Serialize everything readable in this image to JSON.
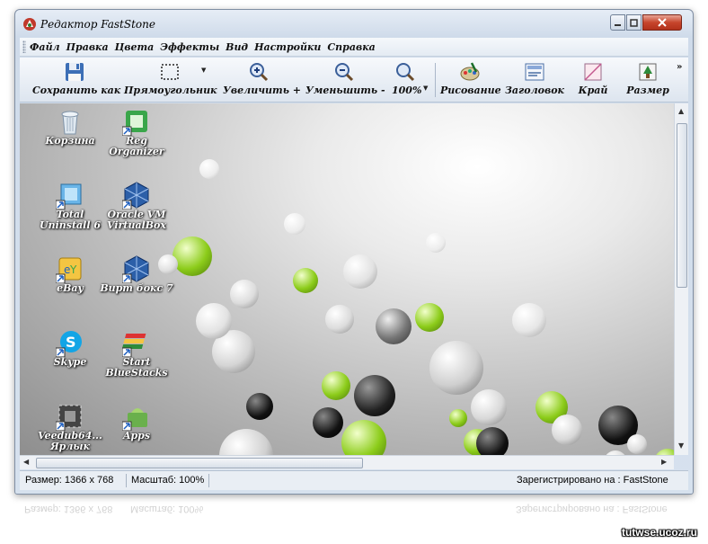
{
  "window": {
    "title": "Редактор FastStone",
    "app_icon": "faststone-icon"
  },
  "menu": [
    "Файл",
    "Правка",
    "Цвета",
    "Эффекты",
    "Вид",
    "Настройки",
    "Справка"
  ],
  "toolbar": {
    "save": "Сохранить как",
    "rect": "Прямоугольник",
    "zoom_in": "Увеличить +",
    "zoom_out": "Уменьшить -",
    "zoom": "100%",
    "draw": "Рисование",
    "caption": "Заголовок",
    "edge": "Край",
    "resize": "Размер"
  },
  "desktop_icons": [
    {
      "label": "Корзина",
      "icon": "recycle-bin-icon"
    },
    {
      "label": "Reg Organizer",
      "icon": "reg-organizer-icon"
    },
    {
      "label": "Total Uninstall 6",
      "icon": "total-uninstall-icon"
    },
    {
      "label": "Oracle VM VirtualBox",
      "icon": "virtualbox-icon"
    },
    {
      "label": "eBay",
      "icon": "ebay-icon"
    },
    {
      "label": "Вирт бокс 7",
      "icon": "virtualbox-icon"
    },
    {
      "label": "Skype",
      "icon": "skype-icon"
    },
    {
      "label": "Start BlueStacks",
      "icon": "bluestacks-icon"
    },
    {
      "label": "Veedub64... Ярлык",
      "icon": "veedub-icon"
    },
    {
      "label": "Apps",
      "icon": "apps-icon"
    }
  ],
  "status": {
    "size": "Размер: 1366 x 768",
    "scale": "Масштаб: 100%",
    "registered": "Зарегистрировано на : FastStone"
  },
  "watermark": "tutwse.ucoz.ru",
  "colors": {
    "accent_green": "#8ccc1a",
    "close_red": "#c7452c",
    "titlebar": "#d6e1ee"
  }
}
